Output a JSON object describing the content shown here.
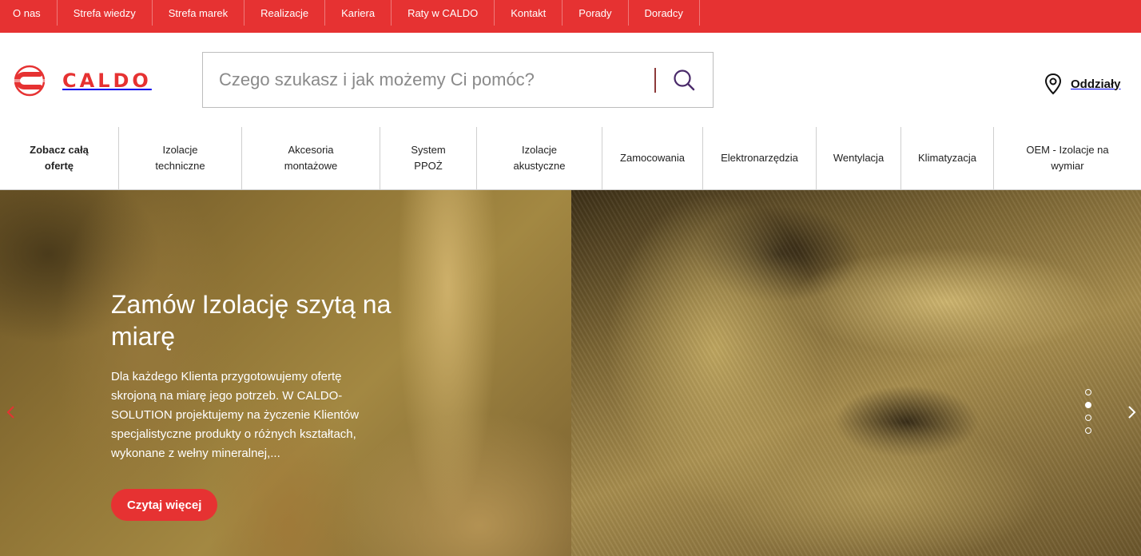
{
  "topbar": {
    "links": [
      "O nas",
      "Strefa wiedzy",
      "Strefa marek",
      "Realizacje",
      "Kariera",
      "Raty w CALDO",
      "Kontakt",
      "Porady",
      "Doradcy"
    ]
  },
  "header": {
    "logo_text": "CALDO",
    "search_placeholder": "Czego szukasz i jak możemy Ci pomóc?",
    "branches_label": "Oddziały"
  },
  "categories": [
    {
      "line1": "Zobacz całą",
      "line2": "ofertę"
    },
    {
      "line1": "Izolacje",
      "line2": "techniczne"
    },
    {
      "line1": "Akcesoria",
      "line2": "montażowe"
    },
    {
      "line1": "System",
      "line2": "PPOŻ"
    },
    {
      "line1": "Izolacje",
      "line2": "akustyczne"
    },
    {
      "line1": "Zamocowania",
      "line2": ""
    },
    {
      "line1": "Elektronarzędzia",
      "line2": ""
    },
    {
      "line1": "Wentylacja",
      "line2": ""
    },
    {
      "line1": "Klimatyzacja",
      "line2": ""
    },
    {
      "line1": "OEM - Izolacje na",
      "line2": "wymiar"
    }
  ],
  "hero": {
    "title": "Zamów Izolację szytą na miarę",
    "text": "Dla każdego Klienta przygotowujemy ofertę skrojoną na miarę jego potrzeb. W CALDO-SOLUTION projektujemy na życzenie Klientów specjalistyczne produkty o różnych kształtach, wykonane z wełny mineralnej,...",
    "button_label": "Czytaj więcej",
    "slides_total": 4,
    "active_slide": 2
  },
  "colors": {
    "brand_red": "#e63232",
    "text_dark": "#222222"
  }
}
